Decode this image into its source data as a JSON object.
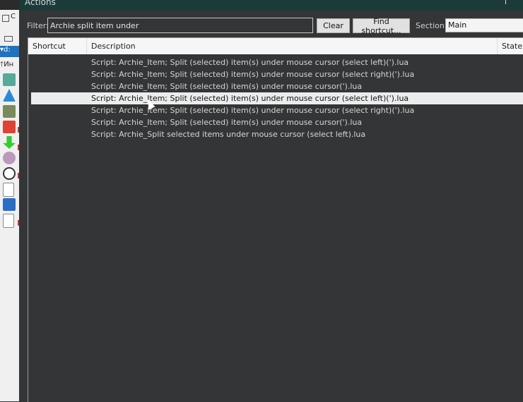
{
  "window": {
    "title": "Actions"
  },
  "side_strip": {
    "item_label_1": "C",
    "drive_label": "d:",
    "item_label_2": "Ин"
  },
  "filter": {
    "label": "Filter:",
    "value": "Archie split item under"
  },
  "buttons": {
    "clear": "Clear",
    "find_shortcut": "Find shortcut..."
  },
  "section": {
    "label": "Section:",
    "value": "Main"
  },
  "list": {
    "columns": {
      "shortcut": "Shortcut",
      "description": "Description",
      "state": "State"
    },
    "rows": [
      {
        "shortcut": "",
        "description": "Script: Archie_Item;  Split (selected) item(s) under mouse cursor (select left)(').lua",
        "state": ""
      },
      {
        "shortcut": "",
        "description": "Script: Archie_Item;  Split (selected) item(s) under mouse cursor (select right)(').lua",
        "state": ""
      },
      {
        "shortcut": "",
        "description": "Script: Archie_Item;  Split (selected) item(s) under mouse cursor(').lua",
        "state": ""
      },
      {
        "shortcut": "",
        "description": "Script: Archie_Item; Split (selected) item(s) under mouse cursor (select left)(').lua",
        "state": "",
        "selected": true
      },
      {
        "shortcut": "",
        "description": "Script: Archie_Item; Split (selected) item(s) under mouse cursor (select right)(').lua",
        "state": ""
      },
      {
        "shortcut": "",
        "description": "Script: Archie_Item; Split (selected) item(s) under mouse cursor(').lua",
        "state": ""
      },
      {
        "shortcut": "",
        "description": "Script: Archie_Split selected items under mouse cursor (select left).lua",
        "state": ""
      }
    ]
  },
  "colors": {
    "title_bar": "#1c3a38",
    "list_bg": "#333537",
    "selected_row": "#ececec"
  }
}
